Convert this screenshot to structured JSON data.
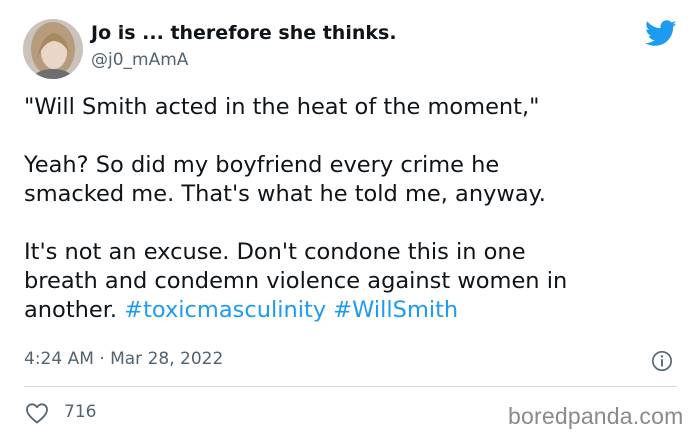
{
  "author": {
    "display_name": "Jo is ... therefore she thinks.",
    "handle": "@j0_mAmA"
  },
  "tweet": {
    "line1": "\"Will Smith acted in the heat of the moment,\"",
    "para2_line1": "Yeah? So did my boyfriend every crime he",
    "para2_line2": "smacked me. That's what he told me, anyway.",
    "para3_line1": "It's not an excuse. Don't condone this in one",
    "para3_line2": "breath and condemn violence against women in",
    "para3_line3_text": "another.",
    "hashtag1": "#toxicmasculinity",
    "hashtag2": "#WillSmith"
  },
  "meta": {
    "timestamp": "4:24 AM · Mar 28, 2022"
  },
  "engagement": {
    "likes": "716"
  },
  "watermark": "boredpanda.com",
  "icons": {
    "brand": "twitter-bird-icon",
    "info": "info-icon",
    "like": "heart-icon"
  },
  "colors": {
    "twitter_blue": "#1d9bf0",
    "secondary_text": "#536471",
    "primary_text": "#0f1419"
  }
}
